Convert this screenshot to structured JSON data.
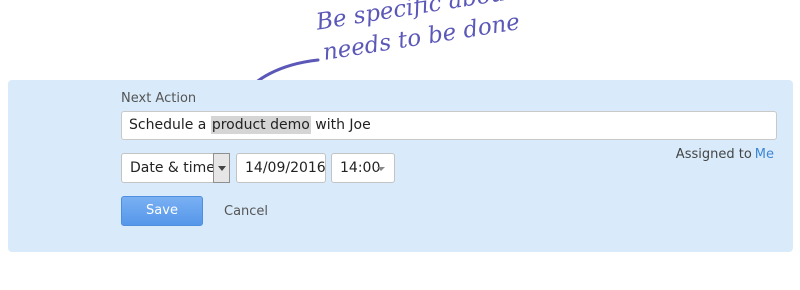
{
  "annotation": {
    "line1": "Be specific about what",
    "line2": "needs to be done",
    "color": "#5b58b8"
  },
  "form": {
    "next_action_label": "Next Action",
    "action_text_before": "Schedule a ",
    "action_text_highlight": "product demo",
    "action_text_after": " with Joe",
    "assigned_label": "Assigned to",
    "assigned_value": "Me",
    "due_type_selected": "Date & time",
    "date_value": "14/09/2016",
    "time_value": "14:00",
    "save_label": "Save",
    "cancel_label": "Cancel"
  },
  "colors": {
    "panel_bg": "#d9ebfb",
    "save_button": "#5697ea",
    "link": "#3d86d6"
  }
}
